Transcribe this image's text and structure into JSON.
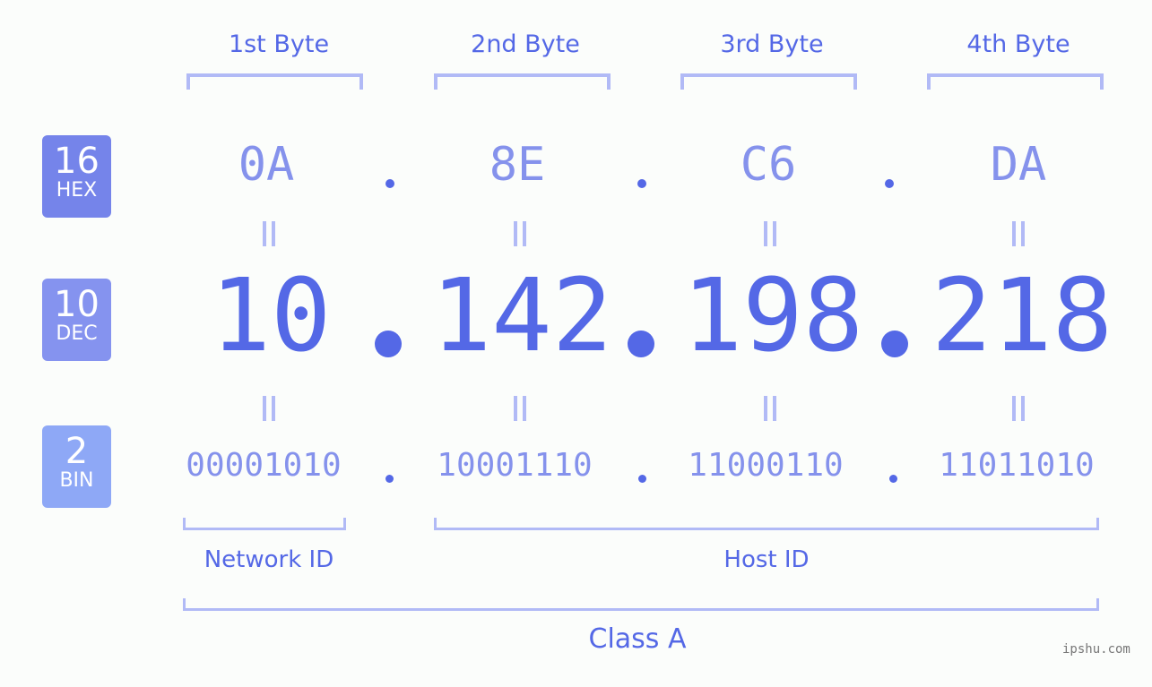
{
  "byte_headers": [
    "1st Byte",
    "2nd Byte",
    "3rd Byte",
    "4th Byte"
  ],
  "badges": {
    "hex": {
      "number": "16",
      "label": "HEX",
      "color": "#7584ea"
    },
    "dec": {
      "number": "10",
      "label": "DEC",
      "color": "#8593ef"
    },
    "bin": {
      "number": "2",
      "label": "BIN",
      "color": "#8ea8f6"
    }
  },
  "hex_values": [
    "0A",
    "8E",
    "C6",
    "DA"
  ],
  "dec_values": [
    "10",
    "142",
    "198",
    "218"
  ],
  "bin_values": [
    "00001010",
    "10001110",
    "11000110",
    "11011010"
  ],
  "network_label": "Network ID",
  "host_label": "Host ID",
  "class_label": "Class A",
  "watermark": "ipshu.com",
  "colors": {
    "primary": "#5468e6",
    "secondary": "#8592ec",
    "bracket": "#b1baf6"
  }
}
